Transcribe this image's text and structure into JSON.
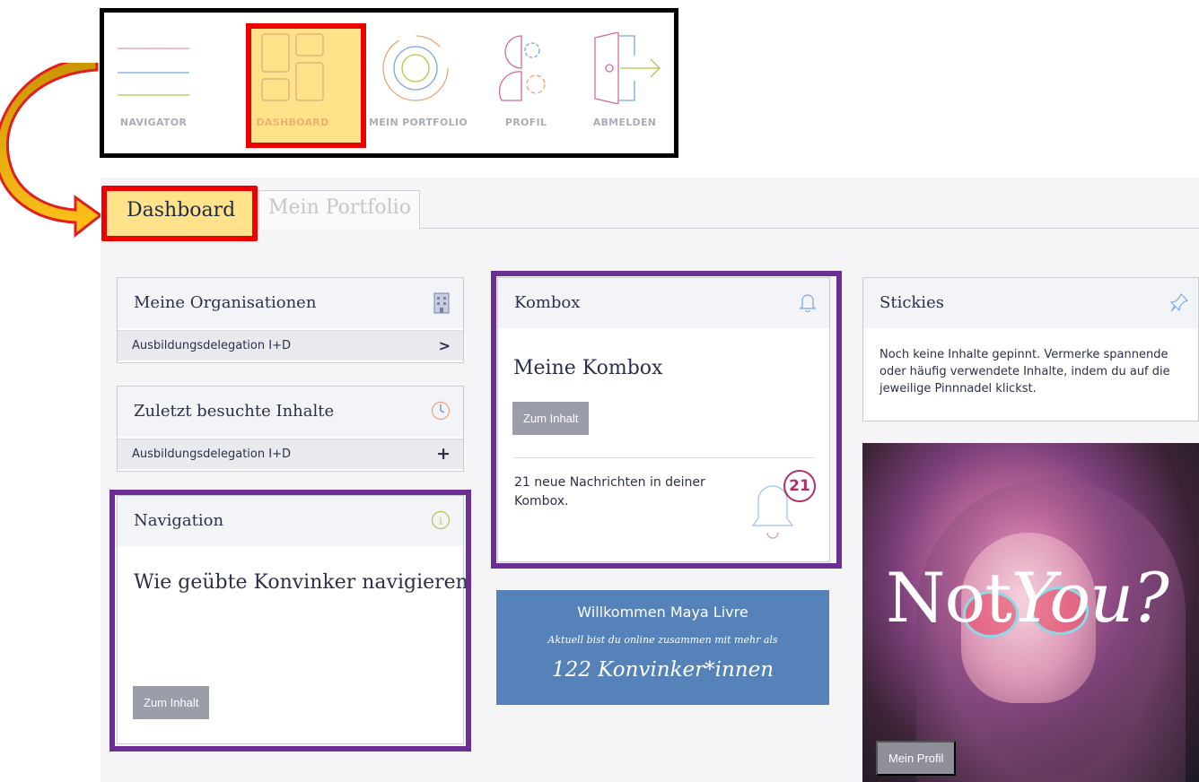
{
  "topnav": {
    "items": [
      {
        "label": "NAVIGATOR",
        "icon": "hamburger-icon"
      },
      {
        "label": "DASHBOARD",
        "icon": "dashboard-grid-icon"
      },
      {
        "label": "MEIN PORTFOLIO",
        "icon": "target-circle-icon"
      },
      {
        "label": "PROFIL",
        "icon": "profile-gears-icon"
      },
      {
        "label": "ABMELDEN",
        "icon": "logout-door-icon"
      }
    ]
  },
  "tabs": [
    {
      "label": "Dashboard",
      "active": true
    },
    {
      "label": "Mein Portfolio",
      "active": false
    }
  ],
  "cards": {
    "organisationen": {
      "title": "Meine Organisationen",
      "row": "Ausbildungsdelegation I+D"
    },
    "zuletzt": {
      "title": "Zuletzt besuchte Inhalte",
      "row": "Ausbildungsdelegation I+D"
    },
    "navigation": {
      "title": "Navigation",
      "heading": "Wie geübte Konvinker navigieren",
      "button": "Zum Inhalt"
    },
    "kombox": {
      "title": "Kombox",
      "heading": "Meine Kombox",
      "button": "Zum Inhalt",
      "message": "21 neue Nachrichten in deiner Kombox.",
      "badge": "21"
    },
    "stickies": {
      "title": "Stickies",
      "text": "Noch keine Inhalte gepinnt. Vermerke spannende oder häufig verwendete Inhalte, indem du auf die jeweilige Pinnnadel klickst."
    }
  },
  "welcome": {
    "greeting": "Willkommen Maya Livre",
    "online": "Aktuell bist du online zusammen mit mehr als",
    "count": "122 Konvinker*innen"
  },
  "promo": {
    "text_regular": "Not",
    "text_italic": "You?",
    "button": "Mein Profil"
  },
  "colors": {
    "highlight": "#ffe28a",
    "annotation_red": "#ee0000",
    "annotation_purple": "#6b2f93",
    "welcome_blue": "#5582b8",
    "badge": "#b0306b"
  }
}
